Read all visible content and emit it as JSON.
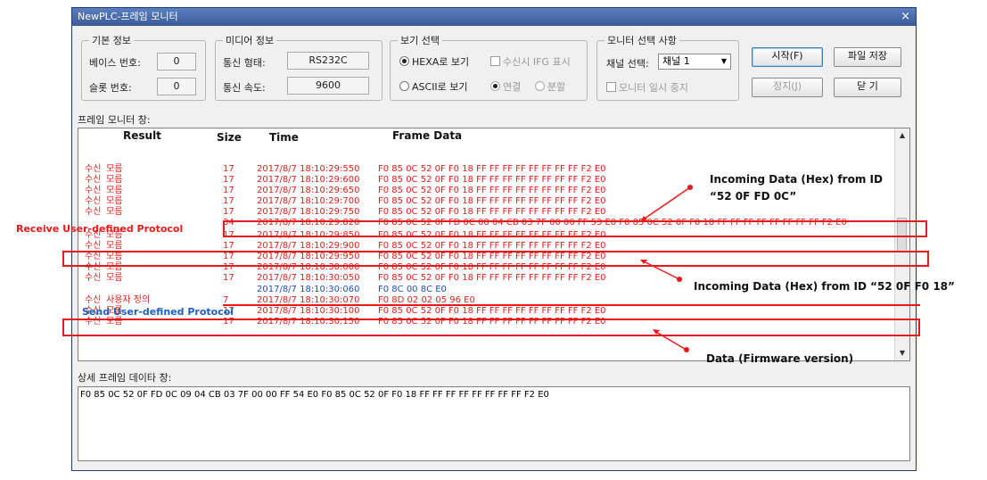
{
  "window": {
    "title": "NewPLC-프레임 모니터",
    "close_glyph": "×"
  },
  "basic_info": {
    "group_label": "기본 정보",
    "base_label": "베이스 번호:",
    "base_value": "0",
    "slot_label": "슬롯 번호:",
    "slot_value": "0"
  },
  "media_info": {
    "group_label": "미디어 정보",
    "type_label": "통신 형태:",
    "type_value": "RS232C",
    "speed_label": "통신 속도:",
    "speed_value": "9600"
  },
  "view_select": {
    "group_label": "보기 선택",
    "hex_label": "HEXA로 보기",
    "ascii_label": "ASCII로 보기",
    "ifg_label": "수신시 IFG 표시",
    "connect_label": "연결",
    "split_label": "분할"
  },
  "monitor_select": {
    "group_label": "모니터 선택 사항",
    "channel_label": "채널 선택:",
    "channel_value": "채널 1",
    "pause_label": "모니터 일시 중지"
  },
  "buttons": {
    "start": "시작(F)",
    "save": "파일 저장",
    "stop": "정지(J)",
    "close": "닫 기"
  },
  "frame_monitor_label": "프레임 모니터 창:",
  "detail_label": "상세 프레임 데이타 창:",
  "columns": {
    "result": "Result",
    "size": "Size",
    "time": "Time",
    "frame": "Frame Data"
  },
  "rows": [
    {
      "dir": "수신",
      "result": "모름",
      "size": "17",
      "time": "2017/8/7 18:10:29:550",
      "data": "F0 85 0C 52 0F F0 18 FF FF FF FF FF FF FF FF F2 E0",
      "color": "red"
    },
    {
      "dir": "수신",
      "result": "모름",
      "size": "17",
      "time": "2017/8/7 18:10:29:600",
      "data": "F0 85 0C 52 0F F0 18 FF FF FF FF FF FF FF FF F2 E0",
      "color": "red"
    },
    {
      "dir": "수신",
      "result": "모름",
      "size": "17",
      "time": "2017/8/7 18:10:29:650",
      "data": "F0 85 0C 52 0F F0 18 FF FF FF FF FF FF FF FF F2 E0",
      "color": "red"
    },
    {
      "dir": "수신",
      "result": "모름",
      "size": "17",
      "time": "2017/8/7 18:10:29:700",
      "data": "F0 85 0C 52 0F F0 18 FF FF FF FF FF FF FF FF F2 E0",
      "color": "red"
    },
    {
      "dir": "수신",
      "result": "모름",
      "size": "17",
      "time": "2017/8/7 18:10:29:750",
      "data": "F0 85 0C 52 0F F0 18 FF FF FF FF FF FF FF FF F2 E0",
      "color": "red"
    },
    {
      "dir": "",
      "result": "",
      "size": "34",
      "time": "2017/8/7 18:10:29:820",
      "data": "F0 85 0C 52 0F FD 0C 08 04 CB 03 7F 00 00 FF 53 E0 F0 85 0C 52 0F F0 18 FF FF FF FF FF FF FF FF F2 E0",
      "color": "red"
    },
    {
      "dir": "수신",
      "result": "모름",
      "size": "17",
      "time": "2017/8/7 18:10:29:850",
      "data": "F0 85 0C 52 0F F0 18 FF FF FF FF FF FF FF FF F2 E0",
      "color": "red"
    },
    {
      "dir": "수신",
      "result": "모름",
      "size": "17",
      "time": "2017/8/7 18:10:29:900",
      "data": "F0 85 0C 52 0F F0 18 FF FF FF FF FF FF FF FF F2 E0",
      "color": "red"
    },
    {
      "dir": "수신",
      "result": "모름",
      "size": "17",
      "time": "2017/8/7 18:10:29:950",
      "data": "F0 85 0C 52 0F F0 18 FF FF FF FF FF FF FF FF F2 E0",
      "color": "red"
    },
    {
      "dir": "수신",
      "result": "모름",
      "size": "17",
      "time": "2017/8/7 18:10:30:000",
      "data": "F0 85 0C 52 0F F0 18 FF FF FF FF FF FF FF FF F2 E0",
      "color": "red"
    },
    {
      "dir": "수신",
      "result": "모름",
      "size": "17",
      "time": "2017/8/7 18:10:30:050",
      "data": "F0 85 0C 52 0F F0 18 FF FF FF FF FF FF FF FF F2 E0",
      "color": "red"
    },
    {
      "dir": "",
      "result": "",
      "size": "",
      "time": "2017/8/7 18:10:30:060",
      "data": "F0 8C 00 8C E0",
      "color": "blue"
    },
    {
      "dir": "수신",
      "result": "사용자 정의",
      "size": "7",
      "time": "2017/8/7 18:10:30:070",
      "data": "F0 8D 02 02 05 96 E0",
      "color": "red"
    },
    {
      "dir": "수신",
      "result": "모름",
      "size": "17",
      "time": "2017/8/7 18:10:30:100",
      "data": "F0 85 0C 52 0F F0 18 FF FF FF FF FF FF FF FF F2 E0",
      "color": "red"
    },
    {
      "dir": "수신",
      "result": "모름",
      "size": "17",
      "time": "2017/8/7 18:10:30:150",
      "data": "F0 85 0C 52 0F F0 18 FF FF FF FF FF FF FF FF F2 E0",
      "color": "red"
    }
  ],
  "detail_text": "F0 85 0C 52 0F FD 0C 09 04 CB 03 7F 00 00 FF 54 E0 F0 85 0C 52 0F F0 18 FF FF FF FF FF FF FF FF F2 E0",
  "annotations": {
    "receive_label": "Receive  User-defined Protocol",
    "send_label": "Send User-defined Protocol",
    "incoming1_line1": "Incoming Data (Hex) from ID",
    "incoming1_line2": "“52 0F FD 0C”",
    "incoming2": "Incoming Data (Hex) from ID “52 0F F0 18”",
    "firmware": "Data (Firmware version)"
  },
  "colors": {
    "received": "#e0201c",
    "sent": "#1f4fbf",
    "highlight": "#e8191a"
  }
}
